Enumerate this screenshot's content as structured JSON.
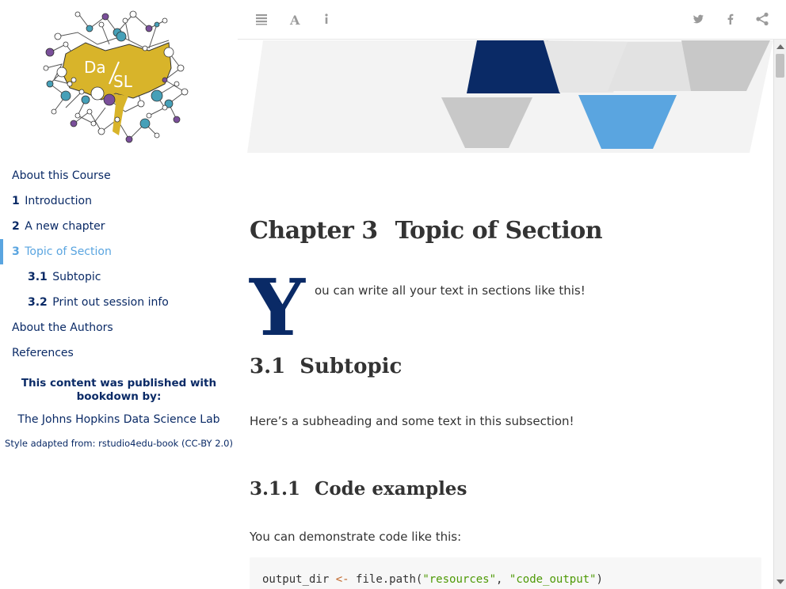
{
  "logo": {
    "text_top": "Da",
    "text_bottom": "SL",
    "accent_color": "#d8b42a"
  },
  "sidebar": {
    "items": [
      {
        "num": "",
        "label": "About this Course"
      },
      {
        "num": "1",
        "label": "Introduction"
      },
      {
        "num": "2",
        "label": "A new chapter"
      },
      {
        "num": "3",
        "label": "Topic of Section",
        "active": true
      },
      {
        "num": "3.1",
        "label": "Subtopic"
      },
      {
        "num": "3.2",
        "label": "Print out session info"
      },
      {
        "num": "",
        "label": "About the Authors"
      },
      {
        "num": "",
        "label": "References"
      }
    ],
    "publish_note": "This content was published with bookdown by:",
    "lab_link": "The Johns Hopkins Data Science Lab",
    "style_note": "Style adapted from: rstudio4edu-book (CC-BY 2.0)"
  },
  "toolbar": {
    "left_icons": [
      "toc-toggle-icon",
      "font-settings-icon",
      "info-icon"
    ],
    "right_icons": [
      "twitter-icon",
      "facebook-icon",
      "share-icon"
    ]
  },
  "content": {
    "chapter_label": "Chapter 3",
    "chapter_title": "Topic of Section",
    "dropcap": "Y",
    "intro_text": "ou can write all your text in sections like this!",
    "section_num": "3.1",
    "section_title": "Subtopic",
    "section_text": "Here’s a subheading and some text in this subsection!",
    "subsection_num": "3.1.1",
    "subsection_title": "Code examples",
    "code_intro": "You can demonstrate code like this:",
    "code": {
      "var": "output_dir",
      "op": "<-",
      "func": "file.path(",
      "arg1": "\"resources\"",
      "sep": ", ",
      "arg2": "\"code_output\"",
      "close": ")"
    }
  },
  "colors": {
    "navy": "#0a2a66",
    "active_blue": "#5aa5e0",
    "string_green": "#4e9a06",
    "operator_orange": "#c0662a"
  }
}
